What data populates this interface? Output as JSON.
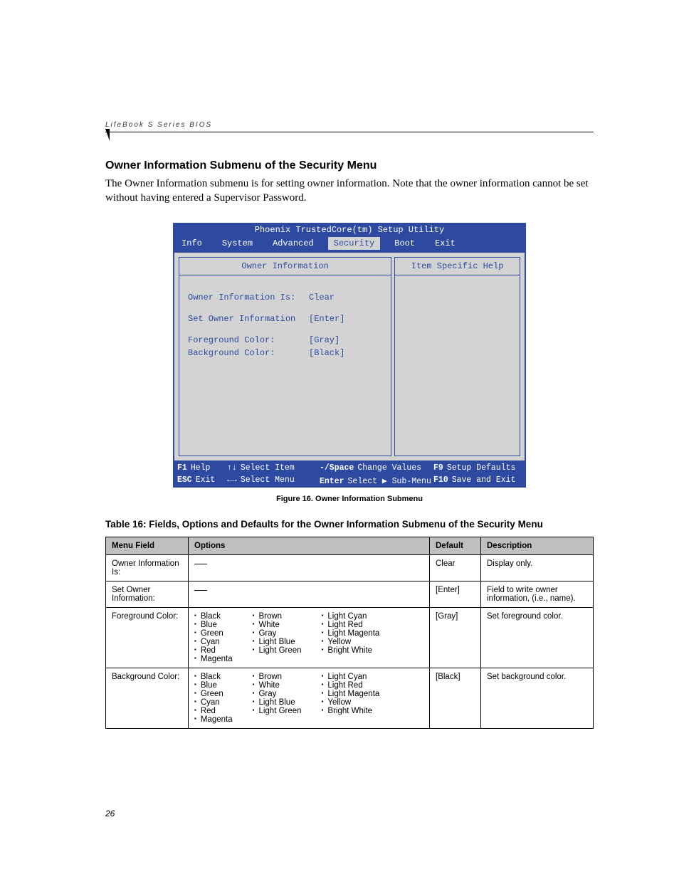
{
  "running_head": "LifeBook S Series BIOS",
  "page_number": "26",
  "section_title": "Owner Information Submenu of the Security Menu",
  "intro": "The Owner Information submenu is for setting owner information. Note that the owner information cannot be set without having entered a Supervisor Password.",
  "figure_caption": "Figure 16.   Owner Information Submenu",
  "bios": {
    "title": "Phoenix TrustedCore(tm) Setup Utility",
    "tabs": [
      "Info",
      "System",
      "Advanced",
      "Security",
      "Boot",
      "Exit"
    ],
    "selected_tab": "Security",
    "pane_title": "Owner Information",
    "help_title": "Item Specific Help",
    "fields": [
      {
        "label": "Owner Information Is:",
        "value": "Clear"
      },
      {
        "label": "Set Owner Information",
        "value": "[Enter]"
      },
      {
        "label": "Foreground Color:",
        "value": "[Gray]"
      },
      {
        "label": "Background Color:",
        "value": "[Black]"
      }
    ],
    "footer": {
      "f1": {
        "key": "F1",
        "label": "Help"
      },
      "esc": {
        "key": "ESC",
        "label": "Exit"
      },
      "ud": {
        "key": "↑↓",
        "label": "Select Item"
      },
      "lr": {
        "key": "←→",
        "label": "Select Menu"
      },
      "sp": {
        "key": "-/Space",
        "label": "Change Values"
      },
      "ent": {
        "key": "Enter",
        "label": "Select ▶ Sub-Menu"
      },
      "f9": {
        "key": "F9",
        "label": "Setup Defaults"
      },
      "f10": {
        "key": "F10",
        "label": "Save and Exit"
      }
    }
  },
  "table_caption": "Table 16: Fields, Options and Defaults for the Owner Information Submenu of the Security Menu",
  "columns": {
    "c1": "Menu Field",
    "c2": "Options",
    "c3": "Default",
    "c4": "Description"
  },
  "rows": [
    {
      "field": "Owner Information Is:",
      "options_dash": true,
      "default": "Clear",
      "desc": "Display only."
    },
    {
      "field": "Set Owner Information:",
      "options_dash": true,
      "default": "[Enter]",
      "desc": "Field to write owner information, (i.e., name)."
    },
    {
      "field": "Foreground Color:",
      "default": "[Gray]",
      "desc": "Set foreground color.",
      "option_cols": [
        [
          "Black",
          "Blue",
          "Green",
          "Cyan",
          "Red",
          "Magenta"
        ],
        [
          "Brown",
          "White",
          "Gray",
          "Light Blue",
          "Light Green"
        ],
        [
          "Light Cyan",
          "Light Red",
          "Light Magenta",
          "Yellow",
          "Bright White"
        ]
      ]
    },
    {
      "field": "Background Color:",
      "default": "[Black]",
      "desc": "Set background color.",
      "option_cols": [
        [
          "Black",
          "Blue",
          "Green",
          "Cyan",
          "Red",
          "Magenta"
        ],
        [
          "Brown",
          "White",
          "Gray",
          "Light Blue",
          "Light Green"
        ],
        [
          "Light Cyan",
          "Light Red",
          "Light Magenta",
          "Yellow",
          "Bright White"
        ]
      ]
    }
  ]
}
